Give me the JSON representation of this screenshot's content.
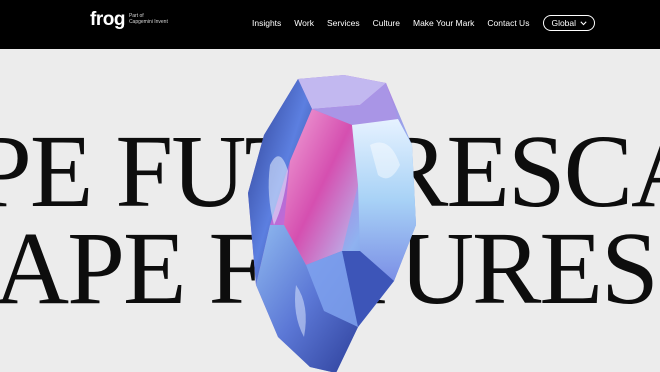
{
  "logo": {
    "name": "frog",
    "tag_line1": "Part of",
    "tag_line2": "Capgemini Invent"
  },
  "nav": {
    "items": [
      "Insights",
      "Work",
      "Services",
      "Culture",
      "Make Your Mark",
      "Contact Us"
    ],
    "region_label": "Global"
  },
  "hero": {
    "line1": "PE FUTURESCA",
    "line2": "APE FUTURES"
  },
  "colors": {
    "header_bg": "#000000",
    "page_bg": "#ececec",
    "hero_text": "#0d0d0d"
  }
}
